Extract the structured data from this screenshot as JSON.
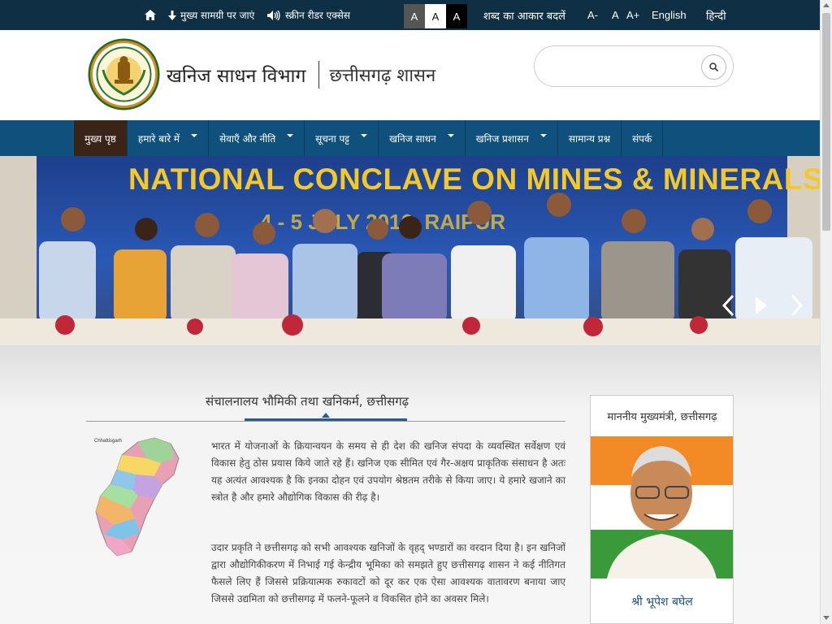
{
  "topbar": {
    "skip_label": "मुख्य सामग्री पर जाएं",
    "reader_label": "स्क्रीन रीडर एक्सेस",
    "contrast": [
      "A",
      "A",
      "A"
    ],
    "font_size_label": "शब्द का आकार बदलें",
    "font_minus": "A-",
    "font_normal": "A",
    "font_plus": "A+",
    "lang_english": "English",
    "lang_hindi": "हिन्दी"
  },
  "header": {
    "dept_name": "खनिज साधन विभाग",
    "gov_name": "छत्तीसगढ़ शासन",
    "search_placeholder": ""
  },
  "nav": {
    "items": [
      {
        "label": "मुख्य पृष्ठ",
        "dropdown": false,
        "active": true
      },
      {
        "label": "हमारे बारे में",
        "dropdown": true
      },
      {
        "label": "सेवाएँ और नीति",
        "dropdown": true
      },
      {
        "label": "सूचना पट्ट",
        "dropdown": true
      },
      {
        "label": "खनिज साधन",
        "dropdown": true
      },
      {
        "label": "खनिज प्रशासन",
        "dropdown": true
      },
      {
        "label": "सामान्य प्रश्न",
        "dropdown": false
      },
      {
        "label": "संपर्क",
        "dropdown": false
      }
    ]
  },
  "banner": {
    "title": "NATIONAL CONCLAVE ON MINES & MINERALS",
    "subtitle": "4 - 5 JULY 2016, RAIPUR"
  },
  "main": {
    "section_title": "संचालनालय भौमिकी तथा खनिकर्म, छत्तीसगढ़",
    "map_label": "Chhattisgarh",
    "paragraph1": "भारत में योजनाओं के क्रियान्वयन के समय से ही देश की खनिज संपदा के व्यवस्थित सर्वेक्षण एवं विकास हेतु ठोस प्रयास किये जाते रहे हैं। खनिज एक सीमित एवं गैर-अक्षय प्राकृतिक संसाधन है अतः यह अत्यंत आवश्यक है कि इनका दोहन एवं उपयोग श्रेष्ठतम तरीके से किया जाए। ये हमारे खजाने का स्त्रोत है और हमारे औद्योगिक विकास की रीढ़ है।",
    "paragraph2": "उदार प्रकृति ने छत्तीसगढ़ को सभी आवश्यक खनिजों के वृहद् भण्डारों का वरदान दिया है। इन खनिजों द्वारा औद्योगिकीकरण में निभाई गई केन्द्रीय भूमिका को समझते हुए छत्तीसगढ़ शासन ने कई नीतिगत फैसले लिए हैं जिससे प्रक्रियात्मक रुकावटों को दूर कर एक ऐसा आवश्यक वातावरण बनाया जाए जिससे उद्यमिता को छत्तीसगढ़ में फलने-फूलने व विकसित होने का अवसर मिले।"
  },
  "cm_card": {
    "title": "माननीय मुख्यमंत्री, छत्तीसगढ़",
    "name": "श्री भूपेश बघेल"
  },
  "colors": {
    "topbar": "#0f2f45",
    "nav": "#10507c",
    "nav_active": "#3a2417",
    "banner_title": "#f3c82a",
    "accent": "#2a5d8f"
  }
}
